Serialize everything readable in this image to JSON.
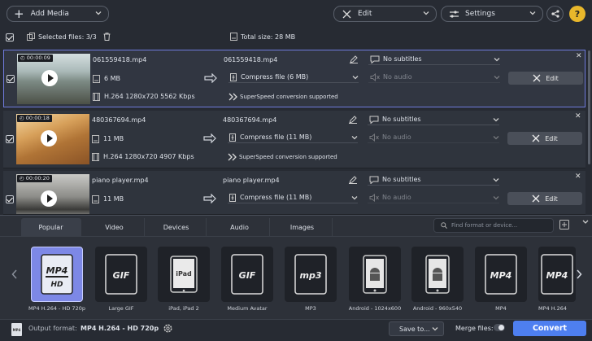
{
  "toolbar": {
    "add_media": "Add Media",
    "edit": "Edit",
    "settings": "Settings"
  },
  "selection": {
    "selected_files": "Selected files: 3/3",
    "total_size": "Total size: 28 MB"
  },
  "files": [
    {
      "duration": "00:00:09",
      "name": "061559418.mp4",
      "output_name": "061559418.mp4",
      "size": "6 MB",
      "codec": "H.264 1280x720 5562 Kbps",
      "compress": "Compress file (6 MB)",
      "subtitles": "No subtitles",
      "audio": "No audio",
      "edit": "Edit",
      "superspeed": "SuperSpeed conversion supported"
    },
    {
      "duration": "00:00:18",
      "name": "480367694.mp4",
      "output_name": "480367694.mp4",
      "size": "11 MB",
      "codec": "H.264 1280x720 4907 Kbps",
      "compress": "Compress file (11 MB)",
      "subtitles": "No subtitles",
      "audio": "No audio",
      "edit": "Edit",
      "superspeed": "SuperSpeed conversion supported"
    },
    {
      "duration": "00:00:20",
      "name": "piano player.mp4",
      "output_name": "piano player.mp4",
      "size": "11 MB",
      "compress": "Compress file (11 MB)",
      "subtitles": "No subtitles",
      "audio": "No audio",
      "edit": "Edit"
    }
  ],
  "tabs": [
    "Popular",
    "Video",
    "Devices",
    "Audio",
    "Images"
  ],
  "search": {
    "placeholder": "Find format or device..."
  },
  "presets": [
    {
      "label": "MP4 H.264 - HD 720p",
      "icon": "mp4-hd-icon",
      "badge": "MP4",
      "sub": "HD"
    },
    {
      "label": "Large GIF",
      "icon": "gif-icon",
      "badge": "GIF"
    },
    {
      "label": "iPad, iPad 2",
      "icon": "ipad-icon",
      "badge": "iPad"
    },
    {
      "label": "Medium Avatar",
      "icon": "gif-icon",
      "badge": "GIF"
    },
    {
      "label": "MP3",
      "icon": "mp3-icon",
      "badge": "mp3"
    },
    {
      "label": "Android - 1024x600",
      "icon": "android-icon"
    },
    {
      "label": "Android - 960x540",
      "icon": "android-icon"
    },
    {
      "label": "MP4",
      "icon": "mp4-icon",
      "badge": "MP4"
    },
    {
      "label": "MP4 H.264",
      "icon": "mp4-icon",
      "badge": "MP4"
    }
  ],
  "footer": {
    "output_label": "Output format:",
    "output_value": "MP4 H.264 - HD 720p",
    "save_to": "Save to...",
    "merge": "Merge files:",
    "convert": "Convert"
  },
  "colors": {
    "accent": "#4e7ff0",
    "selection": "#6f7bdc"
  }
}
